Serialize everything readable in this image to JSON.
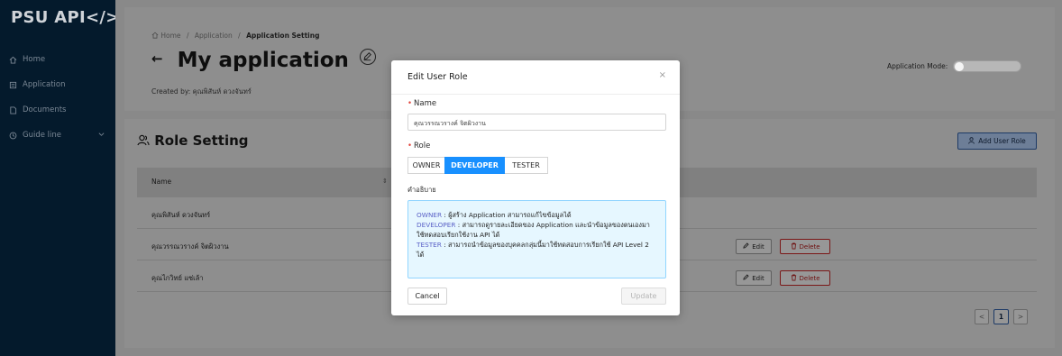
{
  "sidebar": {
    "logo": "PSU API</>",
    "items": [
      {
        "label": "Home",
        "icon": "home-icon"
      },
      {
        "label": "Application",
        "icon": "application-icon"
      },
      {
        "label": "Documents",
        "icon": "document-icon"
      },
      {
        "label": "Guide line",
        "icon": "guide-icon"
      }
    ]
  },
  "breadcrumb": {
    "home": "Home",
    "sep": "/",
    "application": "Application",
    "current": "Application Setting"
  },
  "page": {
    "back": "←",
    "title": "My application",
    "created_prefix": "Created by:",
    "created_by": "คุณพิสันห์ ดวงจันทร์",
    "mode_label": "Application Mode:"
  },
  "role_section": {
    "title": "Role Setting",
    "add_button": "Add User Role",
    "column_name": "Name",
    "rows": [
      {
        "name": "คุณพิสันห์ ดวงจันทร์",
        "edit": "",
        "delete": ""
      },
      {
        "name": "คุณวรรณวรางค์ จิตผิวงาน",
        "edit": "Edit",
        "delete": "Delete"
      },
      {
        "name": "คุณไกวิทย์ แซ่เล้า",
        "edit": "Edit",
        "delete": "Delete"
      }
    ],
    "pagination": {
      "prev": "<",
      "page": "1",
      "next": ">"
    }
  },
  "modal": {
    "title": "Edit User Role",
    "close": "×",
    "name_label": "Name",
    "name_value": "คุณวรรณวรางค์ จิตผิวงาน",
    "role_label": "Role",
    "roles": [
      "OWNER",
      "DEVELOPER",
      "TESTER"
    ],
    "selected_role": "DEVELOPER",
    "description_label": "คำอธิบาย",
    "descriptions": [
      {
        "key": "OWNER",
        "text": " : ผู้สร้าง Application สามารถแก้ไขข้อมูลได้"
      },
      {
        "key": "DEVELOPER",
        "text": " : สามารถดูรายละเอียดของ Application และนำข้อมูลของตนเองมาใช้ทดสอบเรียกใช้งาน API ได้"
      },
      {
        "key": "TESTER",
        "text": " : สามารถนำข้อมูลของบุคคลกลุ่มนี้มาใช้ทดสอบการเรียกใช้ API Level 2 ได้"
      }
    ],
    "cancel": "Cancel",
    "update": "Update"
  },
  "colors": {
    "sidebar": "#041a2c",
    "primary": "#1890ff",
    "danger": "#e2473f",
    "info_bg": "#e6f7ff"
  }
}
